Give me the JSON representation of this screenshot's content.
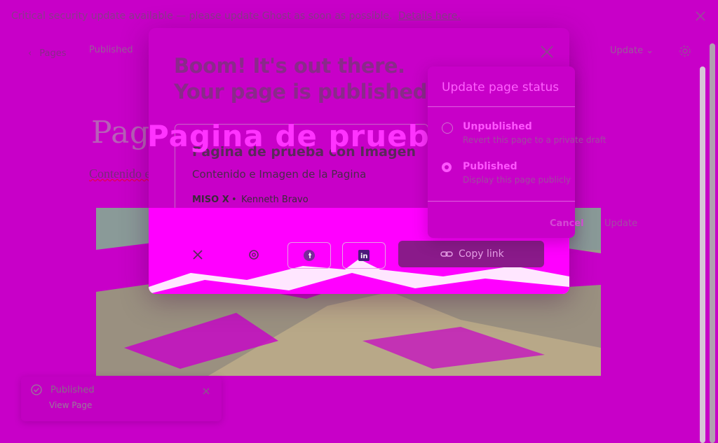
{
  "banner": {
    "message": "Critical security update available — please update Ghost as soon as possible.",
    "link": "Details here."
  },
  "editor": {
    "back_label": "Pages",
    "status_label": "Published",
    "update_label": "Update"
  },
  "page": {
    "title": "Pagina de prueba con",
    "body": "Contenido e Imagen de la Pagina"
  },
  "toast": {
    "title": "Published",
    "action": "View Page"
  },
  "modal": {
    "headline": "Boom! It's out there.\nYour page is published.",
    "overlay_title": "Pagina de prueba con",
    "card": {
      "title": "Pagina de prueba con Imagen",
      "excerpt": "Contenido e Imagen de la Pagina",
      "site": "MISO X",
      "author": "Kenneth Bravo"
    },
    "share_buttons": [
      {
        "icon": "x-icon"
      },
      {
        "icon": "threads-icon"
      },
      {
        "icon": "facebook-icon"
      },
      {
        "icon": "linkedin-icon"
      }
    ],
    "copy_link_label": "Copy link"
  },
  "status_popover": {
    "title": "Update page status",
    "options": [
      {
        "label": "Unpublished",
        "description": "Revert this page to a private draft",
        "selected": false
      },
      {
        "label": "Published",
        "description": "Display this page publicly",
        "selected": true
      }
    ],
    "cancel_label": "Cancel",
    "update_label": "Update"
  },
  "colors": {
    "accent": "#ff00ff",
    "background": "#c800c8",
    "copy_button": "#8a1a8a"
  }
}
